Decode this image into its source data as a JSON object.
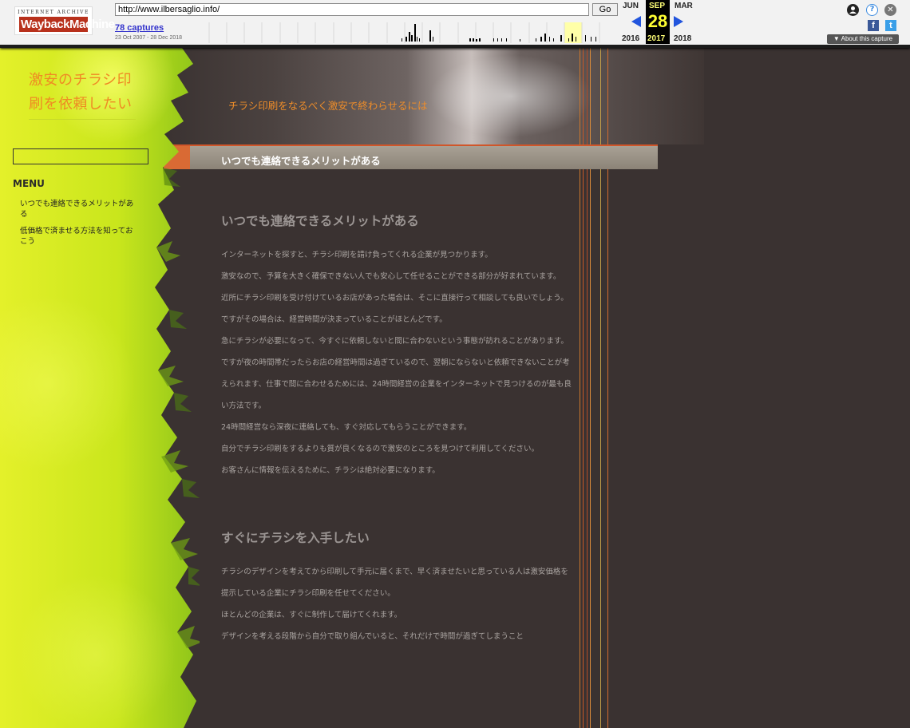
{
  "wayback": {
    "logo_top": "INTERNET ARCHIVE",
    "logo_main": "WaybackMachine",
    "url": "http://www.ilbersaglio.info/",
    "go_label": "Go",
    "captures": "78 captures",
    "range": "23 Oct 2007 - 28 Dec 2018",
    "prev_month": "JUN",
    "cur_month": "SEP",
    "next_month": "MAR",
    "day": "28",
    "prev_year": "2016",
    "cur_year": "2017",
    "next_year": "2018",
    "about": "▼ About this capture",
    "fb": "f",
    "tw": "t",
    "help": "?",
    "close": "✕"
  },
  "site": {
    "title": "激安のチラシ印刷を依頼したい",
    "tagline": "チラシ印刷をなるべく激安で終わらせるには",
    "menu_heading": "MENU",
    "menu_items": [
      "いつでも連絡できるメリットがある",
      "低価格で済ませる方法を知っておこう"
    ],
    "page_title": "いつでも連絡できるメリットがある"
  },
  "content": {
    "sections": [
      {
        "title": "いつでも連絡できるメリットがある",
        "paragraphs": [
          "インターネットを探すと、チラシ印刷を請け負ってくれる企業が見つかります。",
          "激安なので、予算を大きく確保できない人でも安心して任せることができる部分が好まれています。",
          "近所にチラシ印刷を受け付けているお店があった場合は、そこに直接行って相談しても良いでしょう。",
          "ですがその場合は、経営時間が決まっていることがほとんどです。",
          "急にチラシが必要になって、今すぐに依頼しないと間に合わないという事態が訪れることがあります。",
          "ですが夜の時間帯だったらお店の経営時間は過ぎているので、翌朝にならないと依頼できないことが考えられます、仕事で間に合わせるためには、24時間経営の企業をインターネットで見つけるのが最も良い方法です。",
          "24時間経営なら深夜に連絡しても、すぐ対応してもらうことができます。",
          "自分でチラシ印刷をするよりも質が良くなるので激安のところを見つけて利用してください。",
          "お客さんに情報を伝えるために、チラシは絶対必要になります。"
        ]
      },
      {
        "title": "すぐにチラシを入手したい",
        "paragraphs": [
          "チラシのデザインを考えてから印刷して手元に届くまで、早く済ませたいと思っている人は激安価格を提示している企業にチラシ印刷を任せてください。",
          "ほとんどの企業は、すぐに制作して届けてくれます。",
          "デザインを考える段階から自分で取り組んでいると、それだけで時間が過ぎてしまうこと"
        ]
      }
    ]
  }
}
